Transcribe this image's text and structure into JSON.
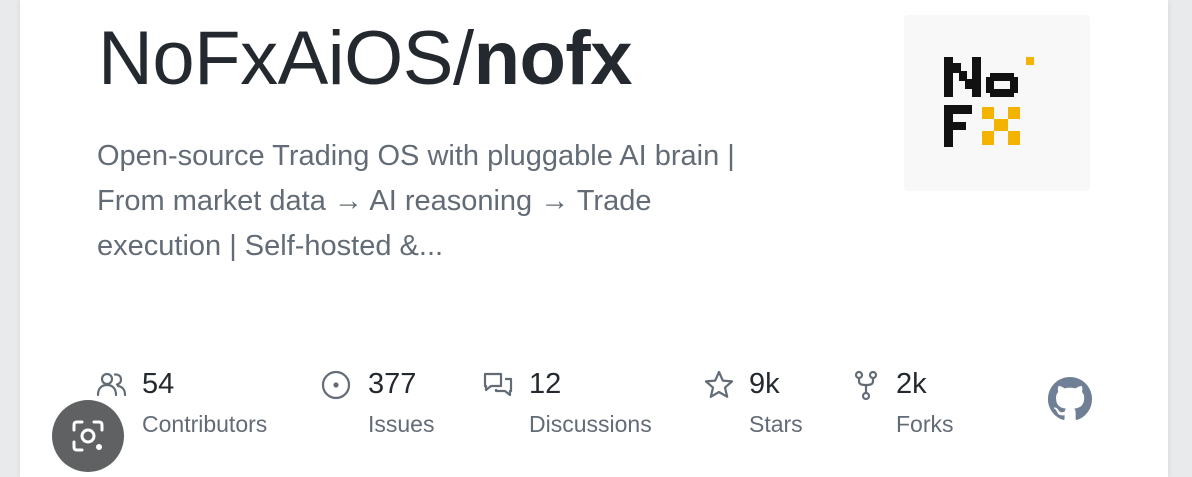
{
  "repo": {
    "owner": "NoFxAiOS/",
    "name": "nofx",
    "description_lines": [
      "Open-source Trading OS with pluggable AI brain |",
      "From market data → AI reasoning → Trade",
      "execution | Self-hosted &..."
    ],
    "logo_text": [
      "No",
      "FX"
    ]
  },
  "stats": [
    {
      "icon": "people-icon",
      "value": "54",
      "label": "Contributors"
    },
    {
      "icon": "issue-icon",
      "value": "377",
      "label": "Issues"
    },
    {
      "icon": "discussions-icon",
      "value": "12",
      "label": "Discussions"
    },
    {
      "icon": "star-icon",
      "value": "9k",
      "label": "Stars"
    },
    {
      "icon": "fork-icon",
      "value": "2k",
      "label": "Forks"
    }
  ],
  "colors": {
    "title": "#24292f",
    "muted": "#636c76",
    "logo_black": "#111111",
    "logo_yellow": "#f5b301",
    "github_icon": "#6e7f96",
    "lens_button": "#5f6162"
  }
}
